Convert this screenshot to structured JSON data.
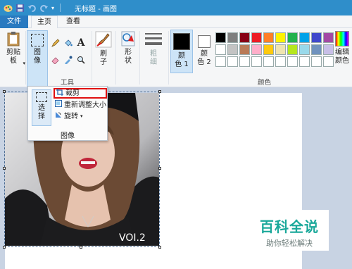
{
  "window": {
    "title": "无标题 - 画图"
  },
  "tabs": {
    "file": "文件",
    "home": "主页",
    "view": "查看"
  },
  "ribbon": {
    "clipboard": {
      "label_line1": "剪贴",
      "label_line2": "板"
    },
    "image": {
      "label_line1": "图",
      "label_line2": "像"
    },
    "tools_group": "工具",
    "brush": {
      "label_line1": "刷",
      "label_line2": "子"
    },
    "shapes": {
      "label_line1": "形",
      "label_line2": "状"
    },
    "size": {
      "label_line1": "粗",
      "label_line2": "细"
    },
    "color1": {
      "label_line1": "颜",
      "label_line2": "色 1"
    },
    "color2": {
      "label_line1": "颜",
      "label_line2": "色 2"
    },
    "edit_colors": {
      "label_line1": "编辑",
      "label_line2": "颜色"
    },
    "colors_group": "颜色",
    "color1_value": "#000000",
    "color2_value": "#ffffff",
    "palette": [
      "#000000",
      "#7f7f7f",
      "#880015",
      "#ed1c24",
      "#ff7f27",
      "#fff200",
      "#22b14c",
      "#00a2e8",
      "#3f48cc",
      "#a349a4",
      "#ffffff",
      "#c3c3c3",
      "#b97a57",
      "#ffaec9",
      "#ffc90e",
      "#efe4b0",
      "#b5e61d",
      "#99d9ea",
      "#7092be",
      "#c8bfe7",
      "#ffffff",
      "#ffffff",
      "#ffffff",
      "#ffffff",
      "#ffffff",
      "#ffffff",
      "#ffffff",
      "#ffffff",
      "#ffffff",
      "#ffffff"
    ]
  },
  "image_menu": {
    "select": {
      "label_line1": "选",
      "label_line2": "择"
    },
    "crop": "裁剪",
    "resize": "重新调整大小",
    "rotate": "旋转",
    "caption": "图像"
  },
  "photo": {
    "caption": "VOI.2"
  },
  "watermark": {
    "logo": "百科全说",
    "subtitle": "助你轻松解决"
  }
}
